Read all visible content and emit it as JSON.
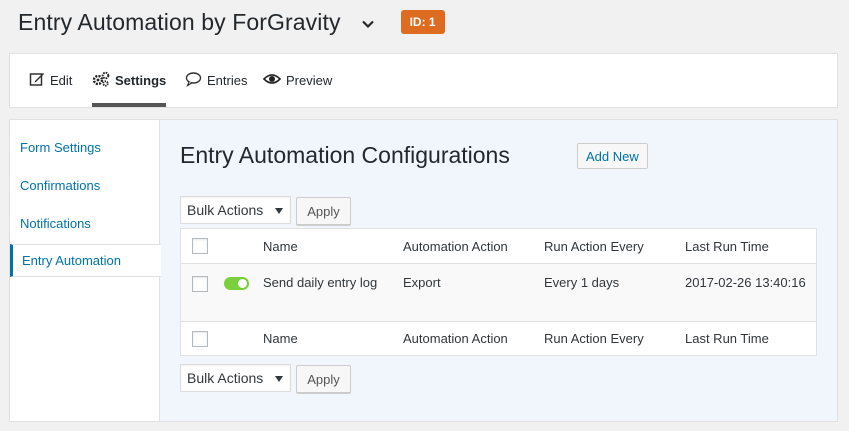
{
  "header": {
    "form_title": "Entry Automation by ForGravity",
    "id_badge": "ID: 1"
  },
  "toolbar": {
    "items": [
      {
        "label": "Edit",
        "icon": "edit-icon"
      },
      {
        "label": "Settings",
        "icon": "gears-icon",
        "active": true
      },
      {
        "label": "Entries",
        "icon": "comment-icon"
      },
      {
        "label": "Preview",
        "icon": "eye-icon"
      }
    ]
  },
  "sidebar": {
    "items": [
      {
        "label": "Form Settings"
      },
      {
        "label": "Confirmations"
      },
      {
        "label": "Notifications"
      },
      {
        "label": "Entry Automation",
        "active": true
      }
    ]
  },
  "main": {
    "heading": "Entry Automation Configurations",
    "add_new_label": "Add New",
    "bulk_actions_label": "Bulk Actions",
    "apply_label": "Apply",
    "columns": [
      "Name",
      "Automation Action",
      "Run Action Every",
      "Last Run Time"
    ],
    "rows": [
      {
        "active": true,
        "name": "Send daily entry log",
        "action": "Export",
        "run_every": "Every 1 days",
        "last_run": "2017-02-26 13:40:16"
      }
    ]
  },
  "colors": {
    "accent": "#0073aa",
    "badge": "#dd6b20",
    "toggle_on": "#7ad03a"
  }
}
